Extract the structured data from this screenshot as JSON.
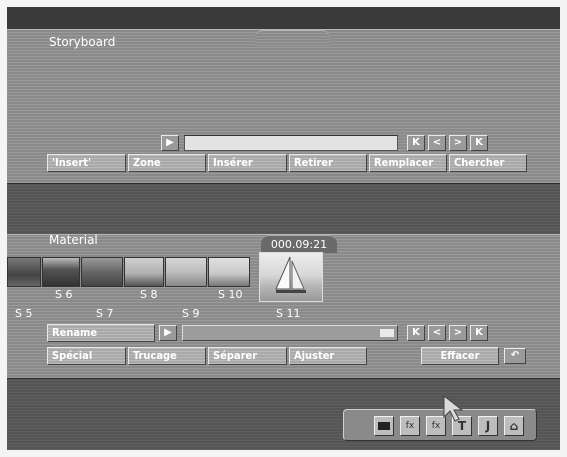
{
  "storyboard": {
    "title": "Storyboard",
    "transport": [
      "K",
      "<",
      ">",
      "K"
    ],
    "buttons": [
      "'Insert'",
      "Zone",
      "Insérer",
      "Retirer",
      "Remplacer",
      "Chercher"
    ]
  },
  "material": {
    "title": "Material",
    "timecode": "000.09:21",
    "scene_labels_row1": [
      "S 6",
      "S 8",
      "S 10"
    ],
    "scene_labels_row2": [
      "S 5",
      "S 7",
      "S 9",
      "S 11"
    ],
    "rename_label": "Rename",
    "transport": [
      "K",
      "<",
      ">",
      "K"
    ],
    "buttons": [
      "Spécial",
      "Trucage",
      "Séparer",
      "Ajuster"
    ],
    "delete_label": "Effacer",
    "undo_icon": "undo-icon"
  },
  "dock": {
    "icons": [
      "camera-icon",
      "fx-icon",
      "fx-icon",
      "text-icon",
      "tools-icon",
      "home-icon"
    ],
    "labels": [
      "",
      "fx",
      "fx",
      "T",
      "J",
      "⌂"
    ]
  },
  "colors": {
    "panel": "#8a8a8a",
    "background": "#555555",
    "button": "#a9a9a9"
  }
}
